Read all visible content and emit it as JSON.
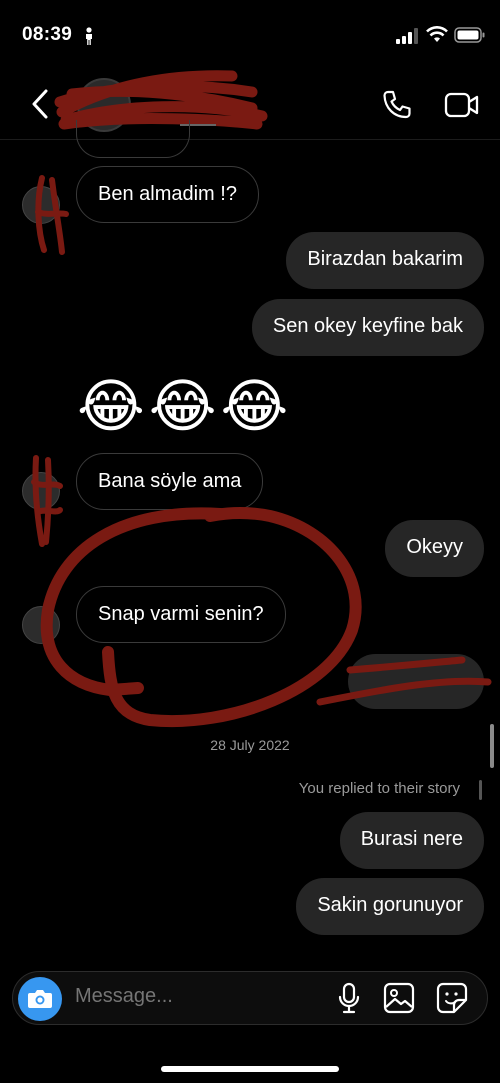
{
  "status_bar": {
    "time": "08:39"
  },
  "header": {
    "contact_name": ""
  },
  "messages": [
    {
      "text": "Ben almadim !?",
      "direction": "in"
    },
    {
      "text": "Birazdan bakarim",
      "direction": "out"
    },
    {
      "text": "Sen okey keyfine bak",
      "direction": "out"
    },
    {
      "text": "😂😂😂",
      "direction": "in",
      "kind": "emoji"
    },
    {
      "text": "Bana söyle ama",
      "direction": "in"
    },
    {
      "text": "Okeyy",
      "direction": "out"
    },
    {
      "text": "Snap varmi senin?",
      "direction": "in"
    },
    {
      "text": "",
      "direction": "out",
      "note": "obscured"
    }
  ],
  "date_separator_1": "28 July 2022",
  "story_reply_note": "You replied to their story",
  "messages_after": [
    {
      "text": "Burasi nere",
      "direction": "out"
    },
    {
      "text": "Sakin gorunuyor",
      "direction": "out"
    }
  ],
  "composer": {
    "placeholder": "Message..."
  },
  "colors": {
    "background": "#000000",
    "outgoing_bubble": "#262626",
    "camera_button": "#3797f0",
    "scribble": "#7a1a12"
  },
  "icons": [
    "person-icon",
    "signal-icon",
    "wifi-icon",
    "battery-icon",
    "back-chevron-icon",
    "phone-icon",
    "video-camera-icon",
    "camera-icon",
    "microphone-icon",
    "gallery-icon",
    "sticker-icon"
  ]
}
